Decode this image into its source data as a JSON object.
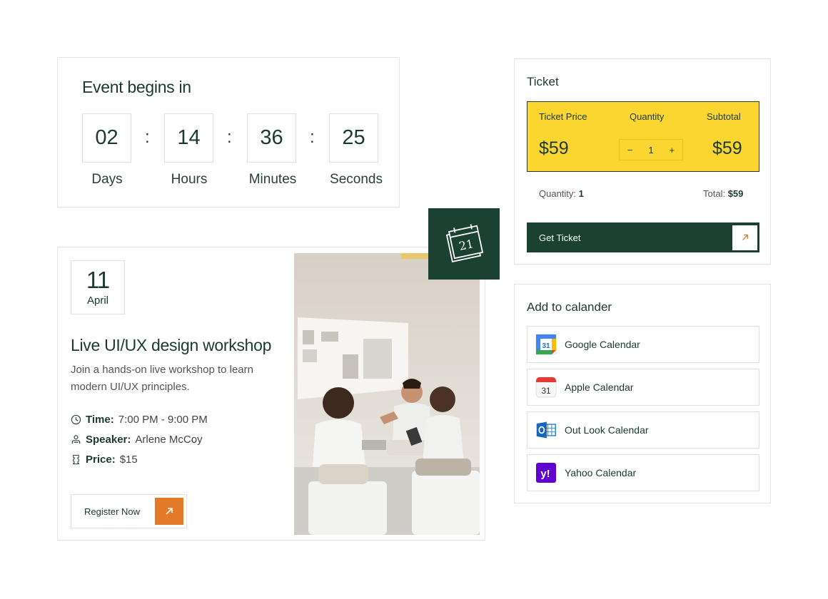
{
  "countdown": {
    "title": "Event begins in",
    "units": [
      {
        "value": "02",
        "label": "Days"
      },
      {
        "value": "14",
        "label": "Hours"
      },
      {
        "value": "36",
        "label": "Minutes"
      },
      {
        "value": "25",
        "label": "Seconds"
      }
    ],
    "separator": ":"
  },
  "workshop": {
    "date_day": "11",
    "date_month": "April",
    "title": "Live UI/UX design workshop",
    "description": "Join a hands-on live workshop to learn modern UI/UX principles.",
    "time_label": "Time:",
    "time_value": "7:00 PM - 9:00 PM",
    "speaker_label": "Speaker:",
    "speaker_value": "Arlene McCoy",
    "price_label": "Price:",
    "price_value": "$15",
    "register_label": "Register Now"
  },
  "calendar_badge": {
    "number": "21"
  },
  "ticket": {
    "title": "Ticket",
    "price_header": "Ticket Price",
    "quantity_header": "Quantity",
    "subtotal_header": "Subtotal",
    "price": "$59",
    "quantity": "1",
    "minus": "−",
    "plus": "+",
    "subtotal": "$59",
    "summary_quantity_label": "Quantity:",
    "summary_quantity_value": "1",
    "summary_total_label": "Total:",
    "summary_total_value": "$59",
    "button_label": "Get Ticket"
  },
  "add_calendar": {
    "title": "Add to calander",
    "items": [
      {
        "label": "Google Calendar",
        "icon": "google-calendar-icon"
      },
      {
        "label": "Apple Calendar",
        "icon": "apple-calendar-icon"
      },
      {
        "label": "Out Look Calendar",
        "icon": "outlook-calendar-icon"
      },
      {
        "label": "Yahoo Calendar",
        "icon": "yahoo-calendar-icon"
      }
    ]
  },
  "colors": {
    "dark_green": "#1b4133",
    "orange": "#e27a28",
    "yellow": "#fcd630",
    "text": "#1b3a2f"
  }
}
